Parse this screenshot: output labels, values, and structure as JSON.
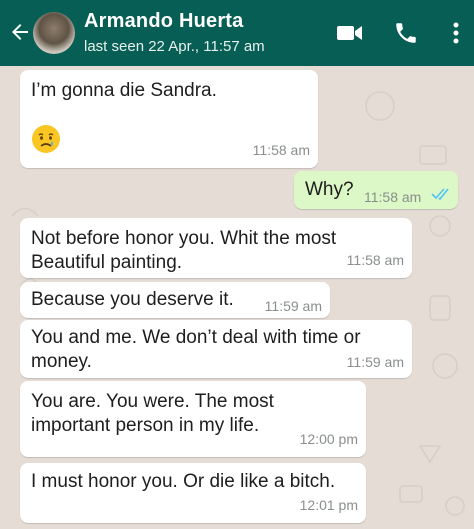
{
  "header": {
    "contact_name": "Armando Huerta",
    "status": "last seen 22 Apr., 11:57 am",
    "icons": [
      "back-arrow-icon",
      "avatar",
      "video-call-icon",
      "phone-call-icon",
      "more-options-icon"
    ],
    "bg_color": "#075e54"
  },
  "messages": [
    {
      "direction": "in",
      "text": "I’m gonna die Sandra.",
      "emoji": "sad-tear-face",
      "time": "11:58 am"
    },
    {
      "direction": "out",
      "text": "Why?",
      "time": "11:58 am",
      "status": "read"
    },
    {
      "direction": "in",
      "lines": [
        "Not before honor you. Whit the most",
        "Beautiful painting."
      ],
      "time": "11:58 am"
    },
    {
      "direction": "in",
      "text": "Because you deserve it.",
      "time": "11:59 am"
    },
    {
      "direction": "in",
      "lines": [
        "You and me. We don’t deal with time or",
        "money."
      ],
      "time": "11:59 am"
    },
    {
      "direction": "in",
      "lines": [
        "You are. You were. The most",
        "important person in my life."
      ],
      "time": "12:00 pm"
    },
    {
      "direction": "in",
      "text": "I must honor you. Or die like a bitch.",
      "time": "12:01 pm"
    }
  ],
  "colors": {
    "chat_bg": "#e5ddd5",
    "incoming": "#ffffff",
    "outgoing": "#dcf8c6",
    "read_ticks": "#4fc3f7"
  }
}
